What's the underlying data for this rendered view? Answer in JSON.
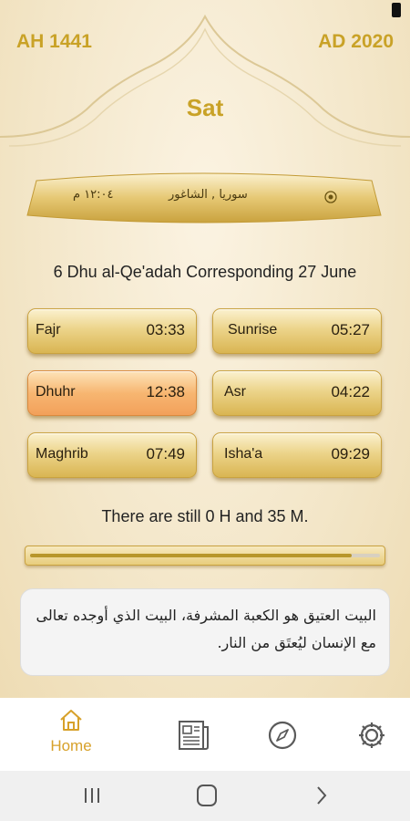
{
  "header": {
    "hijri_year": "AH 1441",
    "gregorian_year": "AD 2020",
    "day": "Sat"
  },
  "location": {
    "time": "١٢:٠٤ م",
    "name": "سوريا , الشاغور",
    "icon": "location-target-icon"
  },
  "date_line": "6 Dhu al-Qe'adah Corresponding 27 June",
  "prayers": [
    {
      "name": "Fajr",
      "time": "03:33",
      "active": false
    },
    {
      "name": "Sunrise",
      "time": "05:27",
      "active": false
    },
    {
      "name": "Dhuhr",
      "time": "12:38",
      "active": true
    },
    {
      "name": "Asr",
      "time": "04:22",
      "active": false
    },
    {
      "name": "Maghrib",
      "time": "07:49",
      "active": false
    },
    {
      "name": "Isha'a",
      "time": "09:29",
      "active": false
    }
  ],
  "countdown": "There are still 0 H and 35 M.",
  "progress": {
    "fraction": 0.92
  },
  "quote": "البيت العتيق هو الكعبة المشرفة، البيت الذي أوجده تعالى مع الإنسان ليُعتَق من النار.",
  "nav": {
    "items": [
      {
        "label": "Home",
        "icon": "home-icon",
        "active": true
      },
      {
        "label": "",
        "icon": "newspaper-icon",
        "active": false
      },
      {
        "label": "",
        "icon": "compass-icon",
        "active": false
      },
      {
        "label": "",
        "icon": "gear-icon",
        "active": false
      }
    ]
  },
  "colors": {
    "gold": "#c9a227",
    "active_prayer": "#f2a05a",
    "nav_active": "#d7a12a"
  }
}
